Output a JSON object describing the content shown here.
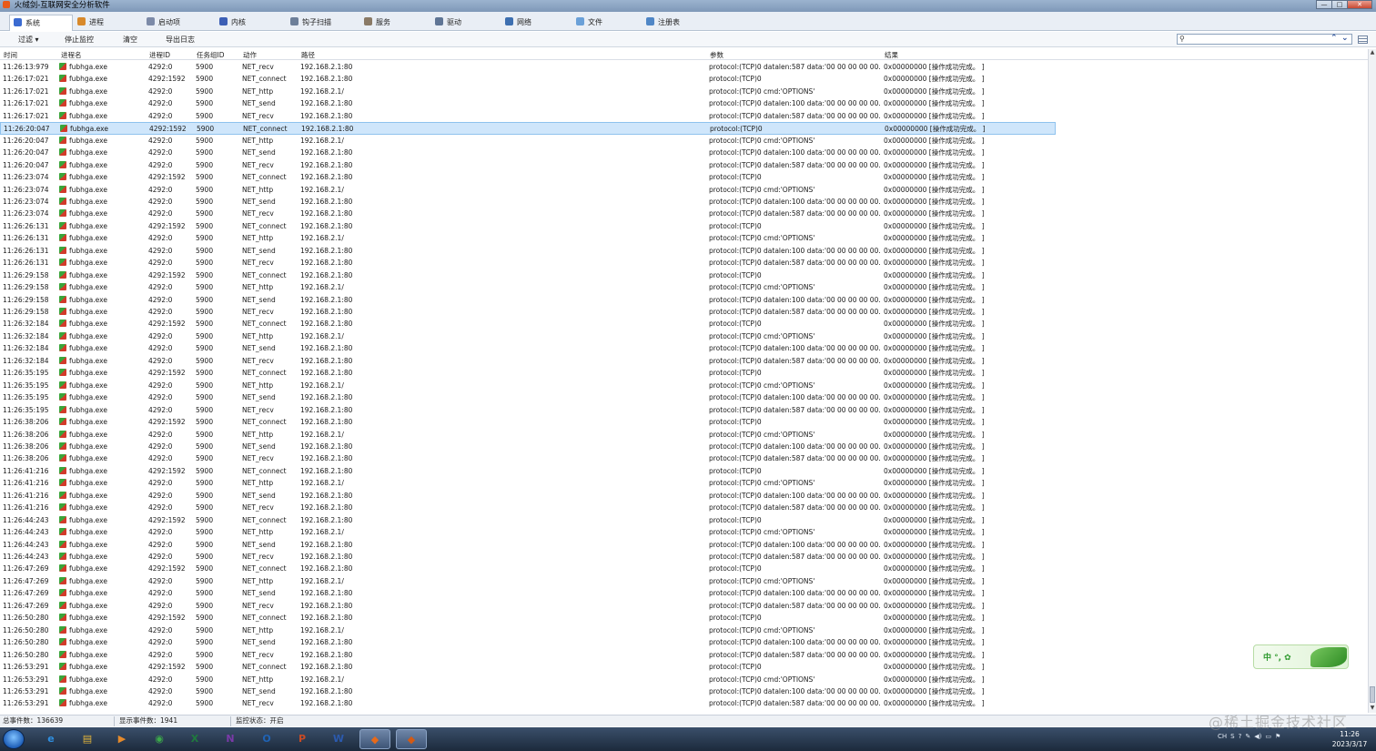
{
  "window": {
    "title": "火绒剑-互联网安全分析软件",
    "controls": [
      "—",
      "□",
      "✕"
    ]
  },
  "tabs": [
    {
      "label": "系统",
      "color": "#3b6bd1",
      "active": true
    },
    {
      "label": "进程",
      "color": "#d8892b"
    },
    {
      "label": "启动项",
      "color": "#7c8aa8"
    },
    {
      "label": "内核",
      "color": "#3c5fb5"
    },
    {
      "label": "钩子扫描",
      "color": "#6d7f99"
    },
    {
      "label": "服务",
      "color": "#8a7a66"
    },
    {
      "label": "驱动",
      "color": "#5f7595"
    },
    {
      "label": "网络",
      "color": "#3d6fb0"
    },
    {
      "label": "文件",
      "color": "#6aa0d8"
    },
    {
      "label": "注册表",
      "color": "#4f86c6"
    }
  ],
  "toolbar": {
    "filter": "过滤 ▾",
    "stop": "停止监控",
    "clear": "清空",
    "export": "导出日志"
  },
  "search": {
    "value": ""
  },
  "columns": {
    "time": "时间",
    "proc": "进程名",
    "pid": "进程ID",
    "task": "任务组ID",
    "act": "动作",
    "path": "路径",
    "param": "参数",
    "res": "结果"
  },
  "selected_row": 5,
  "rows": [
    {
      "time": "11:26:13:979",
      "proc": "fubhga.exe",
      "pid": "4292:0",
      "task": "5900",
      "act": "NET_recv",
      "path": "192.168.2.1:80",
      "param": "protocol:(TCP)0 datalen:587 data:'00 00 00 00 00...",
      "res": "0x00000000 [操作成功完成。 ]"
    },
    {
      "time": "11:26:17:021",
      "proc": "fubhga.exe",
      "pid": "4292:1592",
      "task": "5900",
      "act": "NET_connect",
      "path": "192.168.2.1:80",
      "param": "protocol:(TCP)0",
      "res": "0x00000000 [操作成功完成。 ]"
    },
    {
      "time": "11:26:17:021",
      "proc": "fubhga.exe",
      "pid": "4292:0",
      "task": "5900",
      "act": "NET_http",
      "path": "192.168.2.1/",
      "param": "protocol:(TCP)0 cmd:'OPTIONS'",
      "res": "0x00000000 [操作成功完成。 ]"
    },
    {
      "time": "11:26:17:021",
      "proc": "fubhga.exe",
      "pid": "4292:0",
      "task": "5900",
      "act": "NET_send",
      "path": "192.168.2.1:80",
      "param": "protocol:(TCP)0 datalen:100 data:'00 00 00 00 00...",
      "res": "0x00000000 [操作成功完成。 ]"
    },
    {
      "time": "11:26:17:021",
      "proc": "fubhga.exe",
      "pid": "4292:0",
      "task": "5900",
      "act": "NET_recv",
      "path": "192.168.2.1:80",
      "param": "protocol:(TCP)0 datalen:587 data:'00 00 00 00 00...",
      "res": "0x00000000 [操作成功完成。 ]"
    },
    {
      "time": "11:26:20:047",
      "proc": "fubhga.exe",
      "pid": "4292:1592",
      "task": "5900",
      "act": "NET_connect",
      "path": "192.168.2.1:80",
      "param": "protocol:(TCP)0",
      "res": "0x00000000 [操作成功完成。 ]"
    },
    {
      "time": "11:26:20:047",
      "proc": "fubhga.exe",
      "pid": "4292:0",
      "task": "5900",
      "act": "NET_http",
      "path": "192.168.2.1/",
      "param": "protocol:(TCP)0 cmd:'OPTIONS'",
      "res": "0x00000000 [操作成功完成。 ]"
    },
    {
      "time": "11:26:20:047",
      "proc": "fubhga.exe",
      "pid": "4292:0",
      "task": "5900",
      "act": "NET_send",
      "path": "192.168.2.1:80",
      "param": "protocol:(TCP)0 datalen:100 data:'00 00 00 00 00...",
      "res": "0x00000000 [操作成功完成。 ]"
    },
    {
      "time": "11:26:20:047",
      "proc": "fubhga.exe",
      "pid": "4292:0",
      "task": "5900",
      "act": "NET_recv",
      "path": "192.168.2.1:80",
      "param": "protocol:(TCP)0 datalen:587 data:'00 00 00 00 00...",
      "res": "0x00000000 [操作成功完成。 ]"
    },
    {
      "time": "11:26:23:074",
      "proc": "fubhga.exe",
      "pid": "4292:1592",
      "task": "5900",
      "act": "NET_connect",
      "path": "192.168.2.1:80",
      "param": "protocol:(TCP)0",
      "res": "0x00000000 [操作成功完成。 ]"
    },
    {
      "time": "11:26:23:074",
      "proc": "fubhga.exe",
      "pid": "4292:0",
      "task": "5900",
      "act": "NET_http",
      "path": "192.168.2.1/",
      "param": "protocol:(TCP)0 cmd:'OPTIONS'",
      "res": "0x00000000 [操作成功完成。 ]"
    },
    {
      "time": "11:26:23:074",
      "proc": "fubhga.exe",
      "pid": "4292:0",
      "task": "5900",
      "act": "NET_send",
      "path": "192.168.2.1:80",
      "param": "protocol:(TCP)0 datalen:100 data:'00 00 00 00 00...",
      "res": "0x00000000 [操作成功完成。 ]"
    },
    {
      "time": "11:26:23:074",
      "proc": "fubhga.exe",
      "pid": "4292:0",
      "task": "5900",
      "act": "NET_recv",
      "path": "192.168.2.1:80",
      "param": "protocol:(TCP)0 datalen:587 data:'00 00 00 00 00...",
      "res": "0x00000000 [操作成功完成。 ]"
    },
    {
      "time": "11:26:26:131",
      "proc": "fubhga.exe",
      "pid": "4292:1592",
      "task": "5900",
      "act": "NET_connect",
      "path": "192.168.2.1:80",
      "param": "protocol:(TCP)0",
      "res": "0x00000000 [操作成功完成。 ]"
    },
    {
      "time": "11:26:26:131",
      "proc": "fubhga.exe",
      "pid": "4292:0",
      "task": "5900",
      "act": "NET_http",
      "path": "192.168.2.1/",
      "param": "protocol:(TCP)0 cmd:'OPTIONS'",
      "res": "0x00000000 [操作成功完成。 ]"
    },
    {
      "time": "11:26:26:131",
      "proc": "fubhga.exe",
      "pid": "4292:0",
      "task": "5900",
      "act": "NET_send",
      "path": "192.168.2.1:80",
      "param": "protocol:(TCP)0 datalen:100 data:'00 00 00 00 00...",
      "res": "0x00000000 [操作成功完成。 ]"
    },
    {
      "time": "11:26:26:131",
      "proc": "fubhga.exe",
      "pid": "4292:0",
      "task": "5900",
      "act": "NET_recv",
      "path": "192.168.2.1:80",
      "param": "protocol:(TCP)0 datalen:587 data:'00 00 00 00 00...",
      "res": "0x00000000 [操作成功完成。 ]"
    },
    {
      "time": "11:26:29:158",
      "proc": "fubhga.exe",
      "pid": "4292:1592",
      "task": "5900",
      "act": "NET_connect",
      "path": "192.168.2.1:80",
      "param": "protocol:(TCP)0",
      "res": "0x00000000 [操作成功完成。 ]"
    },
    {
      "time": "11:26:29:158",
      "proc": "fubhga.exe",
      "pid": "4292:0",
      "task": "5900",
      "act": "NET_http",
      "path": "192.168.2.1/",
      "param": "protocol:(TCP)0 cmd:'OPTIONS'",
      "res": "0x00000000 [操作成功完成。 ]"
    },
    {
      "time": "11:26:29:158",
      "proc": "fubhga.exe",
      "pid": "4292:0",
      "task": "5900",
      "act": "NET_send",
      "path": "192.168.2.1:80",
      "param": "protocol:(TCP)0 datalen:100 data:'00 00 00 00 00...",
      "res": "0x00000000 [操作成功完成。 ]"
    },
    {
      "time": "11:26:29:158",
      "proc": "fubhga.exe",
      "pid": "4292:0",
      "task": "5900",
      "act": "NET_recv",
      "path": "192.168.2.1:80",
      "param": "protocol:(TCP)0 datalen:587 data:'00 00 00 00 00...",
      "res": "0x00000000 [操作成功完成。 ]"
    },
    {
      "time": "11:26:32:184",
      "proc": "fubhga.exe",
      "pid": "4292:1592",
      "task": "5900",
      "act": "NET_connect",
      "path": "192.168.2.1:80",
      "param": "protocol:(TCP)0",
      "res": "0x00000000 [操作成功完成。 ]"
    },
    {
      "time": "11:26:32:184",
      "proc": "fubhga.exe",
      "pid": "4292:0",
      "task": "5900",
      "act": "NET_http",
      "path": "192.168.2.1/",
      "param": "protocol:(TCP)0 cmd:'OPTIONS'",
      "res": "0x00000000 [操作成功完成。 ]"
    },
    {
      "time": "11:26:32:184",
      "proc": "fubhga.exe",
      "pid": "4292:0",
      "task": "5900",
      "act": "NET_send",
      "path": "192.168.2.1:80",
      "param": "protocol:(TCP)0 datalen:100 data:'00 00 00 00 00...",
      "res": "0x00000000 [操作成功完成。 ]"
    },
    {
      "time": "11:26:32:184",
      "proc": "fubhga.exe",
      "pid": "4292:0",
      "task": "5900",
      "act": "NET_recv",
      "path": "192.168.2.1:80",
      "param": "protocol:(TCP)0 datalen:587 data:'00 00 00 00 00...",
      "res": "0x00000000 [操作成功完成。 ]"
    },
    {
      "time": "11:26:35:195",
      "proc": "fubhga.exe",
      "pid": "4292:1592",
      "task": "5900",
      "act": "NET_connect",
      "path": "192.168.2.1:80",
      "param": "protocol:(TCP)0",
      "res": "0x00000000 [操作成功完成。 ]"
    },
    {
      "time": "11:26:35:195",
      "proc": "fubhga.exe",
      "pid": "4292:0",
      "task": "5900",
      "act": "NET_http",
      "path": "192.168.2.1/",
      "param": "protocol:(TCP)0 cmd:'OPTIONS'",
      "res": "0x00000000 [操作成功完成。 ]"
    },
    {
      "time": "11:26:35:195",
      "proc": "fubhga.exe",
      "pid": "4292:0",
      "task": "5900",
      "act": "NET_send",
      "path": "192.168.2.1:80",
      "param": "protocol:(TCP)0 datalen:100 data:'00 00 00 00 00...",
      "res": "0x00000000 [操作成功完成。 ]"
    },
    {
      "time": "11:26:35:195",
      "proc": "fubhga.exe",
      "pid": "4292:0",
      "task": "5900",
      "act": "NET_recv",
      "path": "192.168.2.1:80",
      "param": "protocol:(TCP)0 datalen:587 data:'00 00 00 00 00...",
      "res": "0x00000000 [操作成功完成。 ]"
    },
    {
      "time": "11:26:38:206",
      "proc": "fubhga.exe",
      "pid": "4292:1592",
      "task": "5900",
      "act": "NET_connect",
      "path": "192.168.2.1:80",
      "param": "protocol:(TCP)0",
      "res": "0x00000000 [操作成功完成。 ]"
    },
    {
      "time": "11:26:38:206",
      "proc": "fubhga.exe",
      "pid": "4292:0",
      "task": "5900",
      "act": "NET_http",
      "path": "192.168.2.1/",
      "param": "protocol:(TCP)0 cmd:'OPTIONS'",
      "res": "0x00000000 [操作成功完成。 ]"
    },
    {
      "time": "11:26:38:206",
      "proc": "fubhga.exe",
      "pid": "4292:0",
      "task": "5900",
      "act": "NET_send",
      "path": "192.168.2.1:80",
      "param": "protocol:(TCP)0 datalen:100 data:'00 00 00 00 00...",
      "res": "0x00000000 [操作成功完成。 ]"
    },
    {
      "time": "11:26:38:206",
      "proc": "fubhga.exe",
      "pid": "4292:0",
      "task": "5900",
      "act": "NET_recv",
      "path": "192.168.2.1:80",
      "param": "protocol:(TCP)0 datalen:587 data:'00 00 00 00 00...",
      "res": "0x00000000 [操作成功完成。 ]"
    },
    {
      "time": "11:26:41:216",
      "proc": "fubhga.exe",
      "pid": "4292:1592",
      "task": "5900",
      "act": "NET_connect",
      "path": "192.168.2.1:80",
      "param": "protocol:(TCP)0",
      "res": "0x00000000 [操作成功完成。 ]"
    },
    {
      "time": "11:26:41:216",
      "proc": "fubhga.exe",
      "pid": "4292:0",
      "task": "5900",
      "act": "NET_http",
      "path": "192.168.2.1/",
      "param": "protocol:(TCP)0 cmd:'OPTIONS'",
      "res": "0x00000000 [操作成功完成。 ]"
    },
    {
      "time": "11:26:41:216",
      "proc": "fubhga.exe",
      "pid": "4292:0",
      "task": "5900",
      "act": "NET_send",
      "path": "192.168.2.1:80",
      "param": "protocol:(TCP)0 datalen:100 data:'00 00 00 00 00...",
      "res": "0x00000000 [操作成功完成。 ]"
    },
    {
      "time": "11:26:41:216",
      "proc": "fubhga.exe",
      "pid": "4292:0",
      "task": "5900",
      "act": "NET_recv",
      "path": "192.168.2.1:80",
      "param": "protocol:(TCP)0 datalen:587 data:'00 00 00 00 00...",
      "res": "0x00000000 [操作成功完成。 ]"
    },
    {
      "time": "11:26:44:243",
      "proc": "fubhga.exe",
      "pid": "4292:1592",
      "task": "5900",
      "act": "NET_connect",
      "path": "192.168.2.1:80",
      "param": "protocol:(TCP)0",
      "res": "0x00000000 [操作成功完成。 ]"
    },
    {
      "time": "11:26:44:243",
      "proc": "fubhga.exe",
      "pid": "4292:0",
      "task": "5900",
      "act": "NET_http",
      "path": "192.168.2.1/",
      "param": "protocol:(TCP)0 cmd:'OPTIONS'",
      "res": "0x00000000 [操作成功完成。 ]"
    },
    {
      "time": "11:26:44:243",
      "proc": "fubhga.exe",
      "pid": "4292:0",
      "task": "5900",
      "act": "NET_send",
      "path": "192.168.2.1:80",
      "param": "protocol:(TCP)0 datalen:100 data:'00 00 00 00 00...",
      "res": "0x00000000 [操作成功完成。 ]"
    },
    {
      "time": "11:26:44:243",
      "proc": "fubhga.exe",
      "pid": "4292:0",
      "task": "5900",
      "act": "NET_recv",
      "path": "192.168.2.1:80",
      "param": "protocol:(TCP)0 datalen:587 data:'00 00 00 00 00...",
      "res": "0x00000000 [操作成功完成。 ]"
    },
    {
      "time": "11:26:47:269",
      "proc": "fubhga.exe",
      "pid": "4292:1592",
      "task": "5900",
      "act": "NET_connect",
      "path": "192.168.2.1:80",
      "param": "protocol:(TCP)0",
      "res": "0x00000000 [操作成功完成。 ]"
    },
    {
      "time": "11:26:47:269",
      "proc": "fubhga.exe",
      "pid": "4292:0",
      "task": "5900",
      "act": "NET_http",
      "path": "192.168.2.1/",
      "param": "protocol:(TCP)0 cmd:'OPTIONS'",
      "res": "0x00000000 [操作成功完成。 ]"
    },
    {
      "time": "11:26:47:269",
      "proc": "fubhga.exe",
      "pid": "4292:0",
      "task": "5900",
      "act": "NET_send",
      "path": "192.168.2.1:80",
      "param": "protocol:(TCP)0 datalen:100 data:'00 00 00 00 00...",
      "res": "0x00000000 [操作成功完成。 ]"
    },
    {
      "time": "11:26:47:269",
      "proc": "fubhga.exe",
      "pid": "4292:0",
      "task": "5900",
      "act": "NET_recv",
      "path": "192.168.2.1:80",
      "param": "protocol:(TCP)0 datalen:587 data:'00 00 00 00 00...",
      "res": "0x00000000 [操作成功完成。 ]"
    },
    {
      "time": "11:26:50:280",
      "proc": "fubhga.exe",
      "pid": "4292:1592",
      "task": "5900",
      "act": "NET_connect",
      "path": "192.168.2.1:80",
      "param": "protocol:(TCP)0",
      "res": "0x00000000 [操作成功完成。 ]"
    },
    {
      "time": "11:26:50:280",
      "proc": "fubhga.exe",
      "pid": "4292:0",
      "task": "5900",
      "act": "NET_http",
      "path": "192.168.2.1/",
      "param": "protocol:(TCP)0 cmd:'OPTIONS'",
      "res": "0x00000000 [操作成功完成。 ]"
    },
    {
      "time": "11:26:50:280",
      "proc": "fubhga.exe",
      "pid": "4292:0",
      "task": "5900",
      "act": "NET_send",
      "path": "192.168.2.1:80",
      "param": "protocol:(TCP)0 datalen:100 data:'00 00 00 00 00...",
      "res": "0x00000000 [操作成功完成。 ]"
    },
    {
      "time": "11:26:50:280",
      "proc": "fubhga.exe",
      "pid": "4292:0",
      "task": "5900",
      "act": "NET_recv",
      "path": "192.168.2.1:80",
      "param": "protocol:(TCP)0 datalen:587 data:'00 00 00 00 00...",
      "res": "0x00000000 [操作成功完成。 ]"
    },
    {
      "time": "11:26:53:291",
      "proc": "fubhga.exe",
      "pid": "4292:1592",
      "task": "5900",
      "act": "NET_connect",
      "path": "192.168.2.1:80",
      "param": "protocol:(TCP)0",
      "res": "0x00000000 [操作成功完成。 ]"
    },
    {
      "time": "11:26:53:291",
      "proc": "fubhga.exe",
      "pid": "4292:0",
      "task": "5900",
      "act": "NET_http",
      "path": "192.168.2.1/",
      "param": "protocol:(TCP)0 cmd:'OPTIONS'",
      "res": "0x00000000 [操作成功完成。 ]"
    },
    {
      "time": "11:26:53:291",
      "proc": "fubhga.exe",
      "pid": "4292:0",
      "task": "5900",
      "act": "NET_send",
      "path": "192.168.2.1:80",
      "param": "protocol:(TCP)0 datalen:100 data:'00 00 00 00 00...",
      "res": "0x00000000 [操作成功完成。 ]"
    },
    {
      "time": "11:26:53:291",
      "proc": "fubhga.exe",
      "pid": "4292:0",
      "task": "5900",
      "act": "NET_recv",
      "path": "192.168.2.1:80",
      "param": "protocol:(TCP)0 datalen:587 data:'00 00 00 00 00...",
      "res": "0x00000000 [操作成功完成。 ]"
    }
  ],
  "status": {
    "total": "总事件数：136639",
    "shown": "显示事件数：1941",
    "monitor": "监控状态：开启"
  },
  "ime": {
    "label": "中 °, ✿"
  },
  "taskbar": {
    "apps": [
      {
        "name": "ie-icon",
        "glyph": "e",
        "color": "#2f8fe0"
      },
      {
        "name": "explorer-icon",
        "glyph": "▤",
        "color": "#e2b43a"
      },
      {
        "name": "media-player-icon",
        "glyph": "▶",
        "color": "#e58a2b"
      },
      {
        "name": "chrome-icon",
        "glyph": "◉",
        "color": "#3caa4a"
      },
      {
        "name": "excel-icon",
        "glyph": "X",
        "color": "#1f7a3e"
      },
      {
        "name": "onenote-icon",
        "glyph": "N",
        "color": "#7a3aa8"
      },
      {
        "name": "outlook-icon",
        "glyph": "O",
        "color": "#1f63b5"
      },
      {
        "name": "powerpoint-icon",
        "glyph": "P",
        "color": "#c84a24"
      },
      {
        "name": "word-icon",
        "glyph": "W",
        "color": "#2b5aae"
      },
      {
        "name": "huorong-icon",
        "glyph": "◆",
        "color": "#e86a1a",
        "active": true
      },
      {
        "name": "huorong-sword-icon",
        "glyph": "◆",
        "color": "#d35a14",
        "active": true
      }
    ],
    "tray": [
      "CH",
      "S",
      "?",
      "✎",
      "◀)",
      "▭",
      "⚑"
    ],
    "clock_time": "11:26",
    "clock_date": "2023/3/17"
  },
  "watermark": "@稀土掘金技术社区"
}
